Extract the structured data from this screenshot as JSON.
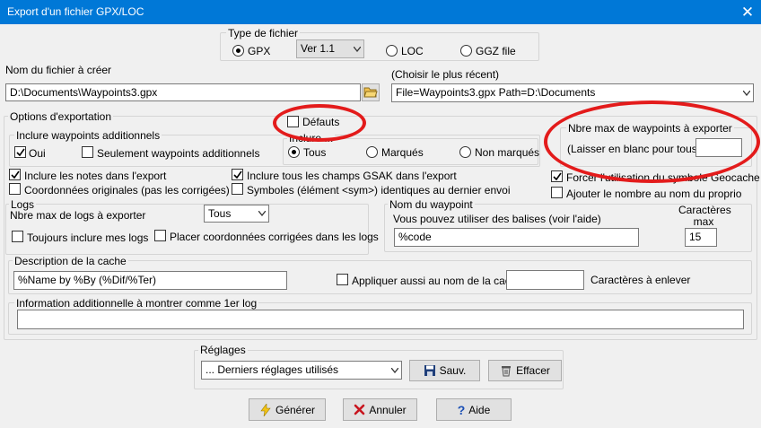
{
  "window": {
    "title": "Export d'un fichier GPX/LOC",
    "close_glyph": "✕"
  },
  "file_type": {
    "legend": "Type de fichier",
    "gpx_label": "GPX",
    "version_selected": "Ver 1.1",
    "loc_label": "LOC",
    "ggz_label": "GGZ file"
  },
  "filename": {
    "label": "Nom du fichier à créer",
    "value": "D:\\Documents\\Waypoints3.gpx"
  },
  "recent": {
    "label": "(Choisir le plus récent)",
    "value": "File=Waypoints3.gpx Path=D:\\Documents"
  },
  "options": {
    "legend": "Options d'exportation",
    "defaults_label": "Défauts",
    "additional": {
      "legend": "Inclure waypoints additionnels",
      "oui_label": "Oui",
      "only_label": "Seulement waypoints additionnels",
      "include_legend": "Inclure ...",
      "tous_label": "Tous",
      "marques_label": "Marqués",
      "non_marques_label": "Non marqués"
    },
    "max_waypoints": {
      "legend": "Nbre max de waypoints à exporter",
      "hint": "(Laisser en blanc pour tous)",
      "value": ""
    },
    "include_notes": "Inclure les notes dans l'export",
    "original_coords": "Coordonnées originales (pas les corrigées)",
    "include_gsak": "Inclure tous les champs GSAK dans l'export",
    "symbols": "Symboles (élément <sym>) identiques au dernier envoi",
    "force_symbol": "Forcer l'utilisation du symbole Geocache",
    "add_number": "Ajouter le nombre au nom du proprio"
  },
  "logs": {
    "legend": "Logs",
    "max_label": "Nbre max de logs à exporter",
    "max_value": "Tous",
    "always_mine": "Toujours inclure mes logs",
    "corrected_coords": "Placer coordonnées corrigées dans les logs"
  },
  "waypoint_name": {
    "legend": "Nom du waypoint",
    "hint": "Vous pouvez utiliser des balises (voir l'aide)",
    "value": "%code",
    "max_chars_label": "Caractères max",
    "max_chars_value": "15"
  },
  "description": {
    "legend": "Description de la cache",
    "value": "%Name by %By (%Dif/%Ter)",
    "apply_label": "Appliquer aussi au nom de la cache",
    "remove_value": "",
    "remove_label": "Caractères à enlever"
  },
  "additional_info": {
    "legend": "Information additionnelle à montrer comme 1er log",
    "value": ""
  },
  "settings": {
    "legend": "Réglages",
    "selected": "... Derniers réglages utilisés",
    "save_label": "Sauv.",
    "clear_label": "Effacer"
  },
  "buttons": {
    "generate": "Générer",
    "cancel": "Annuler",
    "help": "Aide"
  }
}
